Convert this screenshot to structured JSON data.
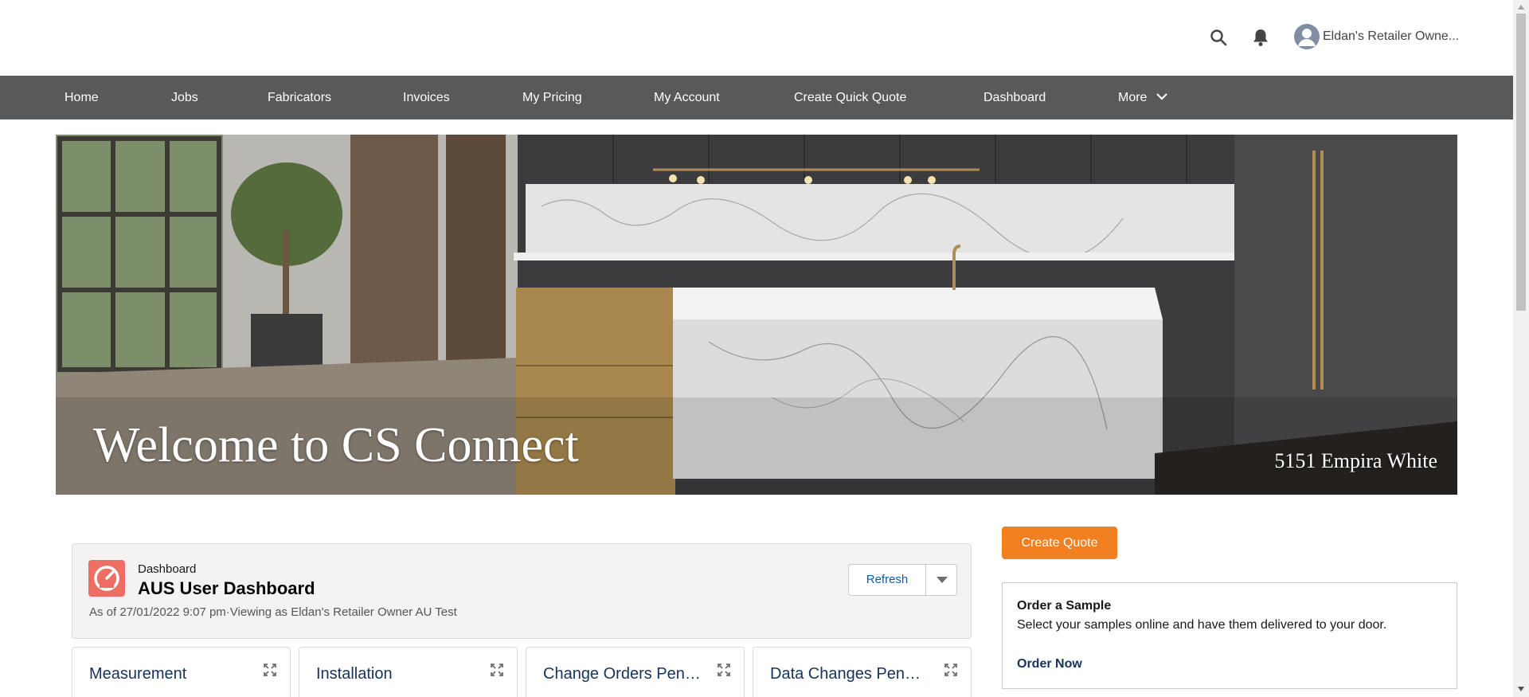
{
  "header": {
    "user_name": "Eldan's Retailer Owne...",
    "icons": [
      "search-icon",
      "bell-icon",
      "user-avatar-icon"
    ]
  },
  "nav": {
    "items": [
      {
        "label": "Home"
      },
      {
        "label": "Jobs"
      },
      {
        "label": "Fabricators"
      },
      {
        "label": "Invoices"
      },
      {
        "label": "My Pricing"
      },
      {
        "label": "My Account"
      },
      {
        "label": "Create Quick Quote"
      },
      {
        "label": "Dashboard"
      },
      {
        "label": "More"
      }
    ]
  },
  "hero": {
    "welcome": "Welcome to CS Connect",
    "caption": "5151 Empira White"
  },
  "dashboard": {
    "label": "Dashboard",
    "title": "AUS User Dashboard",
    "meta": "As of 27/01/2022 9:07 pm·Viewing as Eldan's Retailer Owner AU Test",
    "refresh_label": "Refresh",
    "tiles": [
      {
        "label": "Measurement"
      },
      {
        "label": "Installation"
      },
      {
        "label": "Change Orders Pending"
      },
      {
        "label": "Data Changes Pending"
      }
    ]
  },
  "right": {
    "create_quote_label": "Create Quote",
    "sample": {
      "title": "Order a Sample",
      "description": "Select your samples online and have them delivered to your door.",
      "link": "Order Now"
    }
  },
  "colors": {
    "nav_bg": "#58595b",
    "accent_orange": "#f27f20",
    "dashboard_icon": "#ef6e64",
    "link": "#0b5cab"
  }
}
